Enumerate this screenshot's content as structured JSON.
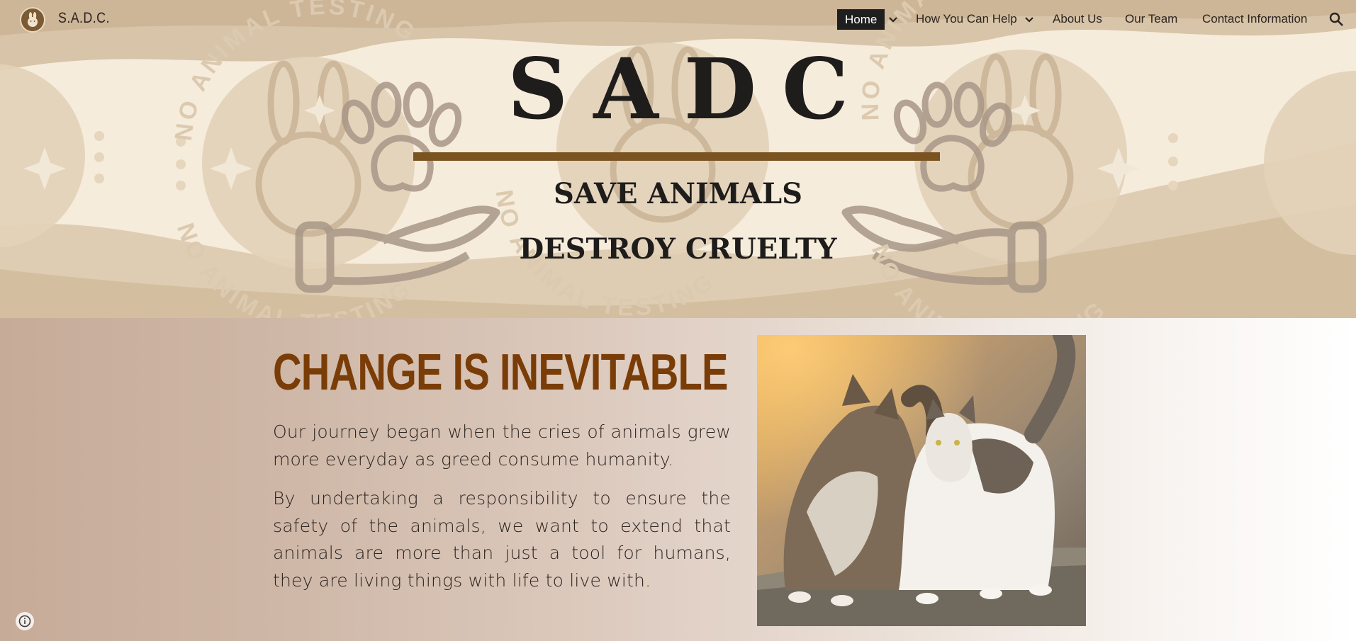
{
  "site": {
    "name": "S.A.D.C.",
    "logo_icon": "bunny-logo-icon"
  },
  "nav": {
    "items": [
      {
        "label": "Home",
        "active": true,
        "has_dropdown": true
      },
      {
        "label": "How You Can Help",
        "active": false,
        "has_dropdown": true
      },
      {
        "label": "About Us",
        "active": false,
        "has_dropdown": false
      },
      {
        "label": "Our Team",
        "active": false,
        "has_dropdown": false
      },
      {
        "label": "Contact Information",
        "active": false,
        "has_dropdown": false
      }
    ],
    "search_icon": "search-icon"
  },
  "hero": {
    "title": "SADC",
    "subtitle_1": "SAVE ANIMALS",
    "subtitle_2": "DESTROY CRUELTY",
    "watermark_text": "NO ANIMAL TESTING"
  },
  "main": {
    "heading": "CHANGE IS INEVITABLE",
    "paragraph_1": "Our journey began when the cries of animals grew more everyday as greed consume humanity.",
    "paragraph_2": "By undertaking a responsibility to ensure the safety of the animals, we want to extend that animals are more than just a tool for humans, they are living things with life to live with."
  },
  "colors": {
    "heading": "#7a3d07",
    "rule": "#7a5320",
    "nav_active_bg": "#1f1f1f"
  }
}
